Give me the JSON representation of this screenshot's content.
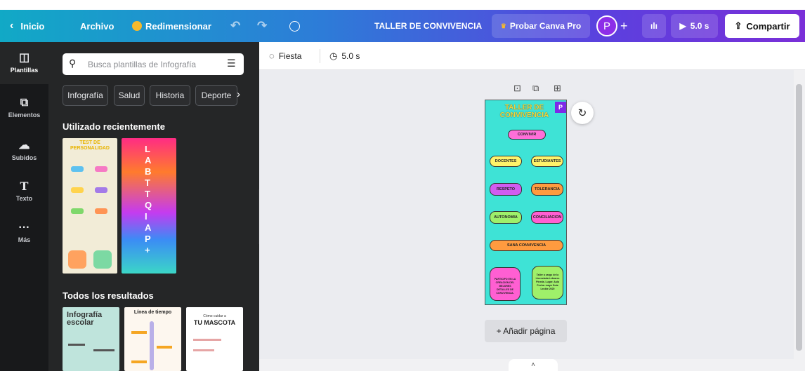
{
  "topbar": {
    "back": "Inicio",
    "file": "Archivo",
    "resize": "Redimensionar",
    "design_title": "TALLER DE CONVIVENCIA",
    "try_pro": "Probar Canva Pro",
    "avatar": "P",
    "duration": "5.0 s",
    "share": "Compartir"
  },
  "rail": [
    {
      "label": "Plantillas",
      "icon": "template-icon"
    },
    {
      "label": "Elementos",
      "icon": "elements-icon"
    },
    {
      "label": "Subidos",
      "icon": "upload-icon"
    },
    {
      "label": "Texto",
      "icon": "text-icon"
    },
    {
      "label": "Más",
      "icon": "more-icon"
    }
  ],
  "panel": {
    "search_placeholder": "Busca plantillas de Infografía",
    "chips": [
      "Infografía",
      "Salud",
      "Historia",
      "Deporte"
    ],
    "recent_heading": "Utilizado recientemente",
    "results_heading": "Todos los resultados",
    "recent": {
      "a_title": "TEST DE PERSONALIDAD",
      "b_letters": "LABTTQIAP+"
    },
    "results": {
      "r1": "Infografía escolar",
      "r2": "Línea de tiempo",
      "r3_top": "Cómo cuidar a",
      "r3_main": "TU MASCOTA"
    }
  },
  "toolbar2": {
    "animation": "Fiesta",
    "duration": "5.0 s"
  },
  "design": {
    "title": "TALLER DE CONVIVENCIA",
    "badge": "P",
    "nodes": {
      "convivir": "CONVIVIR",
      "docentes": "DOCENTES",
      "estudiantes": "ESTUDIANTES",
      "respeto": "RESPETO",
      "tolerancia": "TOLERANCIA",
      "autonomia": "AUTONOMIA",
      "conciliacion": "CONCILIACION",
      "sana": "SANA CONVIVENCIA"
    },
    "note_left": "PARTICIPO EN LA CREACIÓN DEL MEJORES DETALLES DE CONVIVENCIA.",
    "note_right": "Taller a cargo de la Licenciada Lebrares Pineda. Lugar: Aula Fecha: mayo Guía Leobie 2020"
  },
  "add_page": "+ Añadir página",
  "colors": {
    "accent": "#7d2ae8",
    "rail_bg": "#18191b",
    "panel_bg": "#252627"
  }
}
